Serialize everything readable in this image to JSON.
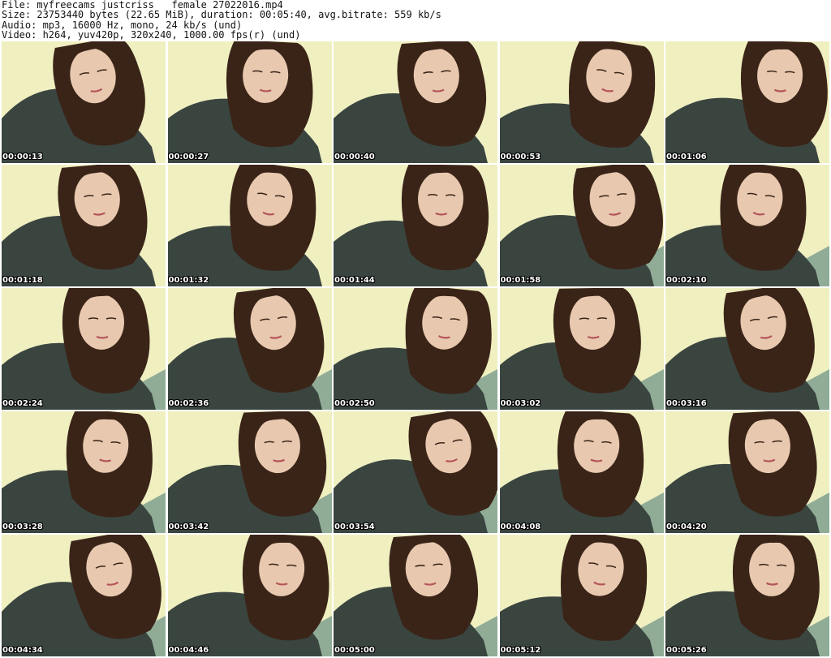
{
  "header": {
    "file_line": "File: myfreecams_justcriss___female_27022016.mp4",
    "size_line": "Size: 23753440 bytes (22.65 MiB), duration: 00:05:40, avg.bitrate: 559 kb/s",
    "audio_line": "Audio: mp3, 16000 Hz, mono, 24 kb/s (und)",
    "video_line": "Video: h264, yuv420p, 320x240, 1000.00 fps(r) (und)"
  },
  "thumbnails": [
    {
      "timestamp": "00:00:13"
    },
    {
      "timestamp": "00:00:27"
    },
    {
      "timestamp": "00:00:40"
    },
    {
      "timestamp": "00:00:53"
    },
    {
      "timestamp": "00:01:06"
    },
    {
      "timestamp": "00:01:18"
    },
    {
      "timestamp": "00:01:32"
    },
    {
      "timestamp": "00:01:44"
    },
    {
      "timestamp": "00:01:58"
    },
    {
      "timestamp": "00:02:10"
    },
    {
      "timestamp": "00:02:24"
    },
    {
      "timestamp": "00:02:36"
    },
    {
      "timestamp": "00:02:50"
    },
    {
      "timestamp": "00:03:02"
    },
    {
      "timestamp": "00:03:16"
    },
    {
      "timestamp": "00:03:28"
    },
    {
      "timestamp": "00:03:42"
    },
    {
      "timestamp": "00:03:54"
    },
    {
      "timestamp": "00:04:08"
    },
    {
      "timestamp": "00:04:20"
    },
    {
      "timestamp": "00:04:34"
    },
    {
      "timestamp": "00:04:46"
    },
    {
      "timestamp": "00:05:00"
    },
    {
      "timestamp": "00:05:12"
    },
    {
      "timestamp": "00:05:26"
    }
  ],
  "colors": {
    "background": "#ffffff",
    "header_text": "#111111",
    "wall": "#f0efc0",
    "shirt": "#3a4540",
    "hair": "#3a2418",
    "skin": "#e8c9b0",
    "blanket": "#7fa08f"
  }
}
